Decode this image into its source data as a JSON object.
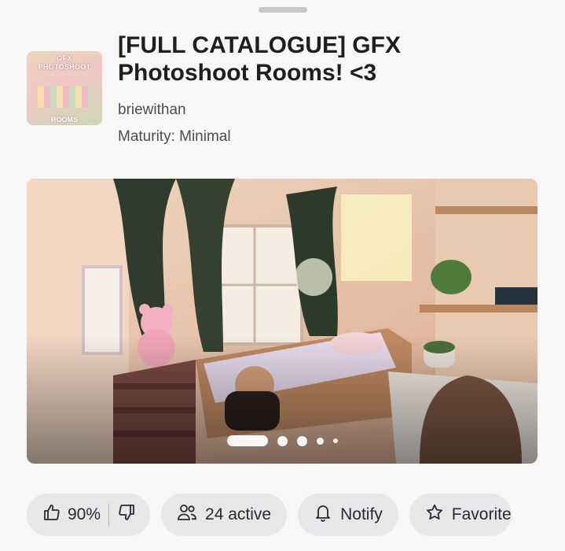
{
  "game": {
    "title_line1": "[FULL CATALOGUE] GFX",
    "title_line2": "Photoshoot Rooms! <3",
    "creator": "briewithan",
    "maturity": "Maturity: Minimal",
    "thumbnail": {
      "top_text_1": "GFX",
      "top_text_2": "PHOTOSHOOT",
      "bottom_text": "ROOMS"
    }
  },
  "carousel": {
    "slide_count": 5,
    "active_index": 0
  },
  "actions": {
    "rating_percent": "90%",
    "active_label": "24 active",
    "notify_label": "Notify",
    "favorite_label": "Favorite"
  },
  "icons": {
    "thumbs_up": "thumbs-up-icon",
    "thumbs_down": "thumbs-down-icon",
    "people": "people-icon",
    "bell": "bell-icon",
    "star": "star-icon"
  }
}
